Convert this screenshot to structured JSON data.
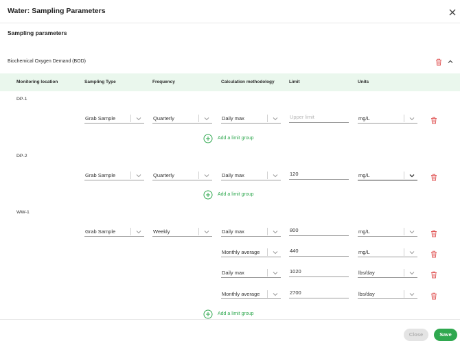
{
  "dialog": {
    "title": "Water: Sampling Parameters",
    "section_title": "Sampling parameters",
    "parameter_name": "Biochemical Oxygen Demand (BOD)"
  },
  "table": {
    "headers": [
      "Monitoring location",
      "Sampling Type",
      "Frequency",
      "Calculation methodology",
      "Limit",
      "Units"
    ]
  },
  "locations": [
    {
      "name": "DP-1",
      "rows": [
        {
          "sampling_type": "Grab Sample",
          "frequency": "Quarterly",
          "calc": "Daily max",
          "limit": "",
          "limit_placeholder": "Upper limit",
          "units": "mg/L"
        }
      ]
    },
    {
      "name": "DP-2",
      "rows": [
        {
          "sampling_type": "Grab Sample",
          "frequency": "Quarterly",
          "calc": "Daily max",
          "limit": "120",
          "units": "mg/L"
        }
      ]
    },
    {
      "name": "WW-1",
      "rows": [
        {
          "sampling_type": "Grab Sample",
          "frequency": "Weekly",
          "calc": "Daily max",
          "limit": "800",
          "units": "mg/L"
        },
        {
          "calc": "Monthly average",
          "limit": "440",
          "units": "mg/L"
        },
        {
          "calc": "Daily max",
          "limit": "1020",
          "units": "lbs/day"
        },
        {
          "calc": "Monthly average",
          "limit": "2700",
          "units": "lbs/day"
        }
      ]
    }
  ],
  "add_limit_group_label": "Add a limit group",
  "buttons": {
    "close": "Close",
    "save": "Save"
  },
  "colors": {
    "accent": "#2fa84f",
    "danger": "#e05454",
    "header_bg": "#eaf7ed"
  },
  "icons": {
    "close": "close-icon",
    "trash": "trash-icon",
    "collapse": "chevron-up-icon",
    "add": "plus-circle-icon",
    "dropdown": "chevron-down-icon"
  }
}
